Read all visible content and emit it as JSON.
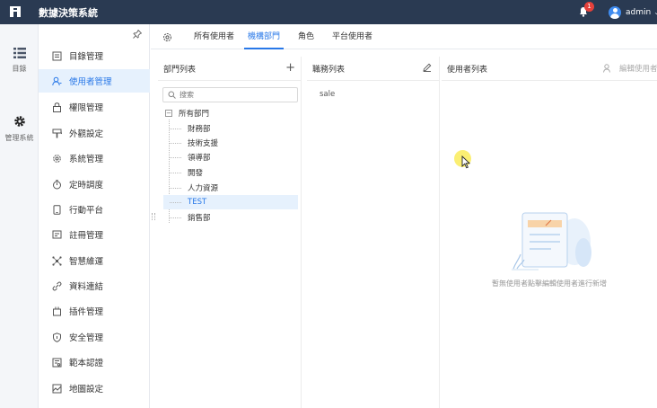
{
  "app": {
    "title": "數據決策系統"
  },
  "header": {
    "notification_count": "1",
    "user_name": "admin"
  },
  "rail": {
    "items": [
      {
        "label": "目錄",
        "icon": "list-icon"
      },
      {
        "label": "管理系統",
        "icon": "gear-icon"
      }
    ]
  },
  "menu": {
    "items": [
      {
        "label": "目錄管理",
        "icon": "book-icon",
        "active": false
      },
      {
        "label": "使用者管理",
        "icon": "user-icon",
        "active": true
      },
      {
        "label": "權限管理",
        "icon": "lock-icon",
        "active": false
      },
      {
        "label": "外觀設定",
        "icon": "brush-icon",
        "active": false
      },
      {
        "label": "系統管理",
        "icon": "gear-icon",
        "active": false
      },
      {
        "label": "定時調度",
        "icon": "timer-icon",
        "active": false
      },
      {
        "label": "行動平台",
        "icon": "mobile-icon",
        "active": false
      },
      {
        "label": "註冊管理",
        "icon": "register-icon",
        "active": false
      },
      {
        "label": "智慧維運",
        "icon": "network-icon",
        "active": false
      },
      {
        "label": "資料連結",
        "icon": "link-icon",
        "active": false
      },
      {
        "label": "插件管理",
        "icon": "plugin-icon",
        "active": false
      },
      {
        "label": "安全管理",
        "icon": "shield-icon",
        "active": false
      },
      {
        "label": "範本認證",
        "icon": "certificate-icon",
        "active": false
      },
      {
        "label": "地圖設定",
        "icon": "map-icon",
        "active": false
      }
    ]
  },
  "tabs": [
    {
      "label": "所有使用者",
      "active": false
    },
    {
      "label": "機構部門",
      "active": true
    },
    {
      "label": "角色",
      "active": false
    },
    {
      "label": "平台使用者",
      "active": false
    }
  ],
  "dept_panel": {
    "title": "部門列表",
    "search_placeholder": "搜索",
    "root": "所有部門",
    "nodes": [
      {
        "label": "財務部",
        "selected": false
      },
      {
        "label": "技術支援",
        "selected": false
      },
      {
        "label": "領導部",
        "selected": false
      },
      {
        "label": "開發",
        "selected": false
      },
      {
        "label": "人力資源",
        "selected": false
      },
      {
        "label": "TEST",
        "selected": true
      },
      {
        "label": "銷售部",
        "selected": false
      }
    ]
  },
  "duty_panel": {
    "title": "職務列表",
    "items": [
      "sale"
    ]
  },
  "users_panel": {
    "title": "使用者列表",
    "edit_label": "編輯使用者",
    "empty_text": "暫無使用者點擊編輯使用者進行新增"
  }
}
